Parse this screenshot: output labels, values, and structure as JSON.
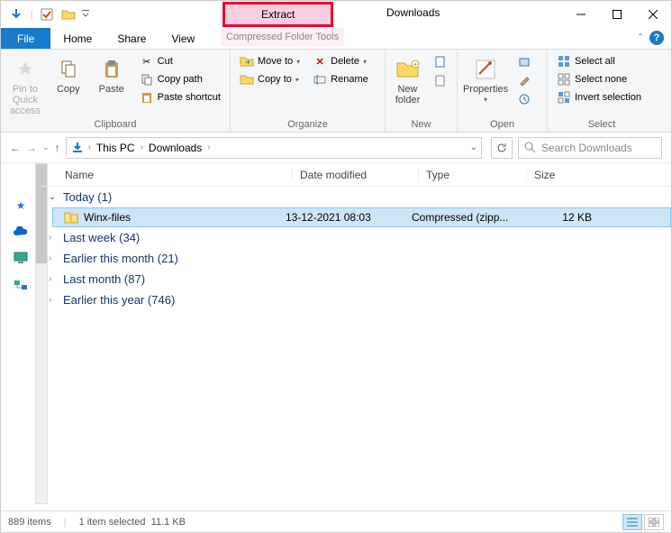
{
  "window": {
    "title": "Downloads"
  },
  "contextual": {
    "tab_label": "Extract",
    "group_label": "Compressed Folder Tools"
  },
  "ribbon_tabs": {
    "file": "File",
    "home": "Home",
    "share": "Share",
    "view": "View"
  },
  "ribbon": {
    "clipboard": {
      "label": "Clipboard",
      "pin": "Pin to Quick access",
      "copy": "Copy",
      "paste": "Paste",
      "cut": "Cut",
      "copy_path": "Copy path",
      "paste_shortcut": "Paste shortcut"
    },
    "organize": {
      "label": "Organize",
      "move_to": "Move to",
      "copy_to": "Copy to",
      "delete": "Delete",
      "rename": "Rename"
    },
    "new": {
      "label": "New",
      "new_folder": "New folder"
    },
    "open": {
      "label": "Open",
      "properties": "Properties"
    },
    "select": {
      "label": "Select",
      "select_all": "Select all",
      "select_none": "Select none",
      "invert": "Invert selection"
    }
  },
  "address": {
    "crumb1": "This PC",
    "crumb2": "Downloads"
  },
  "search": {
    "placeholder": "Search Downloads"
  },
  "columns": {
    "name": "Name",
    "date": "Date modified",
    "type": "Type",
    "size": "Size"
  },
  "groups": [
    {
      "label": "Today (1)",
      "expanded": true
    },
    {
      "label": "Last week (34)",
      "expanded": false
    },
    {
      "label": "Earlier this month (21)",
      "expanded": false
    },
    {
      "label": "Last month (87)",
      "expanded": false
    },
    {
      "label": "Earlier this year (746)",
      "expanded": false
    }
  ],
  "files": [
    {
      "name": "Winx-files",
      "date": "13-12-2021 08:03",
      "type": "Compressed (zipp...",
      "size": "12 KB",
      "selected": true
    }
  ],
  "status": {
    "items": "889 items",
    "selected": "1 item selected",
    "size": "11.1 KB"
  }
}
